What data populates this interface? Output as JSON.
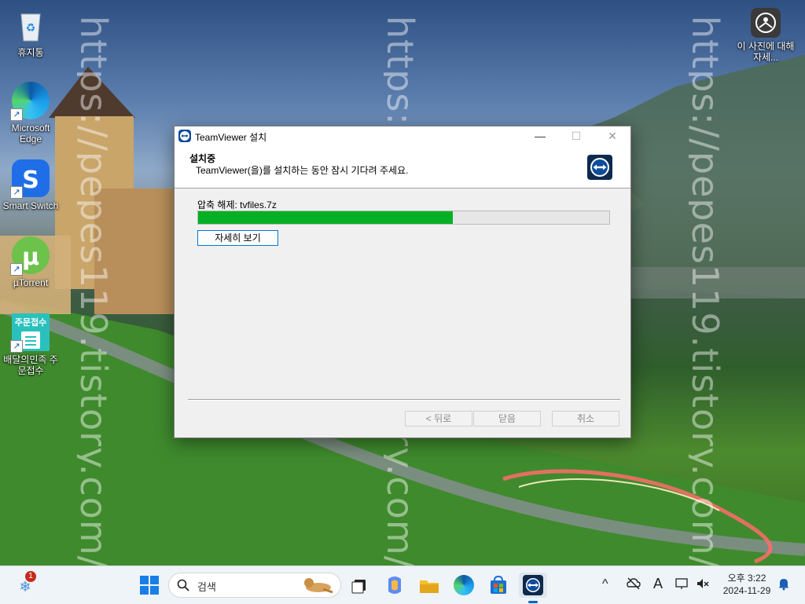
{
  "desktop": {
    "watermark": "https://pepes119.tistory.com/",
    "icons": [
      {
        "label": "휴지통",
        "icon": "recycle-bin-icon"
      },
      {
        "label": "Microsoft Edge",
        "icon": "edge-icon"
      },
      {
        "label": "Smart Switch",
        "icon": "smart-switch-icon"
      },
      {
        "label": "µTorrent",
        "icon": "utorrent-icon"
      },
      {
        "label": "배달의민족 주문접수",
        "icon": "baemin-order-icon",
        "badge": "주문접수"
      }
    ],
    "spotlight": {
      "label": "이 사진에 대해 자세...",
      "icon": "learn-about-picture-icon"
    }
  },
  "installer": {
    "title": "TeamViewer 설치",
    "heading": "설치중",
    "subheading": "TeamViewer(을)를 설치하는 동안 잠시 기다려 주세요.",
    "status": "압축 해제: tvfiles.7z",
    "progress": 0.62,
    "details_button": "자세히 보기",
    "back_button": "< 뒤로",
    "close_button": "닫음",
    "cancel_button": "취소",
    "window_controls": {
      "minimize": "—",
      "maximize": "☐",
      "close": "✕"
    },
    "colors": {
      "progress": "#06b025",
      "teamviewer_blue": "#0e4c9c"
    }
  },
  "taskbar": {
    "widgets_badge": "1",
    "search_placeholder": "검색",
    "pinned": [
      "task-view-icon",
      "copilot-icon",
      "file-explorer-icon",
      "edge-icon",
      "microsoft-store-icon",
      "teamviewer-icon"
    ],
    "tray": {
      "chevron": "^",
      "input_indicator": "A",
      "time": "오후 3:22",
      "date": "2024-11-29"
    }
  }
}
